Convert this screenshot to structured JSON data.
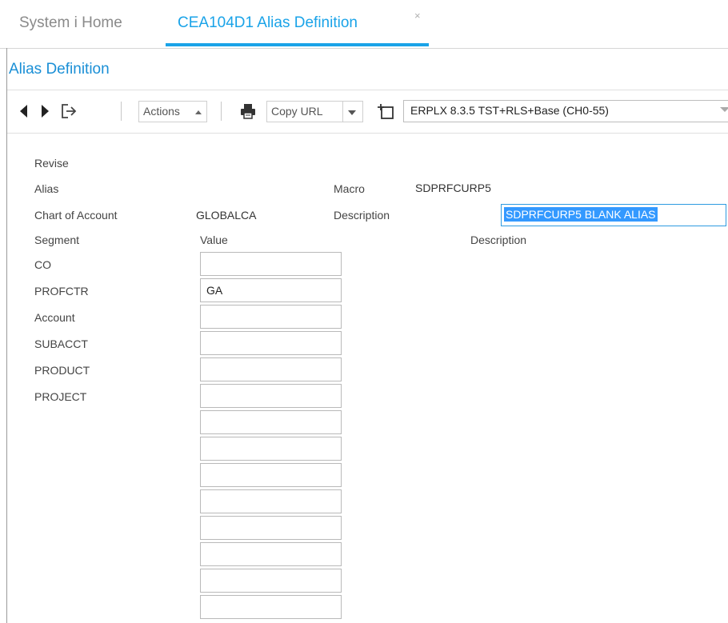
{
  "tabs": {
    "home": "System i Home",
    "active": "CEA104D1 Alias Definition",
    "close": "×"
  },
  "page_title": "Alias Definition",
  "toolbar": {
    "actions_label": "Actions",
    "copy_url_label": "Copy URL",
    "environment": "ERPLX 8.3.5 TST+RLS+Base (CH0-55)"
  },
  "form": {
    "mode": "Revise",
    "alias_label": "Alias",
    "macro_label": "Macro",
    "macro_value": "SDPRFCURP5",
    "coa_label": "Chart of Account",
    "coa_value": "GLOBALCA",
    "description_label": "Description",
    "description_value": "SDPRFCURP5 BLANK ALIAS",
    "col_segment": "Segment",
    "col_value": "Value",
    "col_description": "Description"
  },
  "segments": [
    {
      "name": "CO",
      "value": ""
    },
    {
      "name": "PROFCTR",
      "value": "GA"
    },
    {
      "name": "Account",
      "value": ""
    },
    {
      "name": "SUBACCT",
      "value": ""
    },
    {
      "name": "PRODUCT",
      "value": ""
    },
    {
      "name": "PROJECT",
      "value": ""
    },
    {
      "name": "",
      "value": ""
    },
    {
      "name": "",
      "value": ""
    },
    {
      "name": "",
      "value": ""
    },
    {
      "name": "",
      "value": ""
    },
    {
      "name": "",
      "value": ""
    },
    {
      "name": "",
      "value": ""
    },
    {
      "name": "",
      "value": ""
    },
    {
      "name": "",
      "value": ""
    }
  ],
  "colors": {
    "accent": "#1aa3e8",
    "title": "#1a8fd6",
    "selection": "#3399ff"
  }
}
